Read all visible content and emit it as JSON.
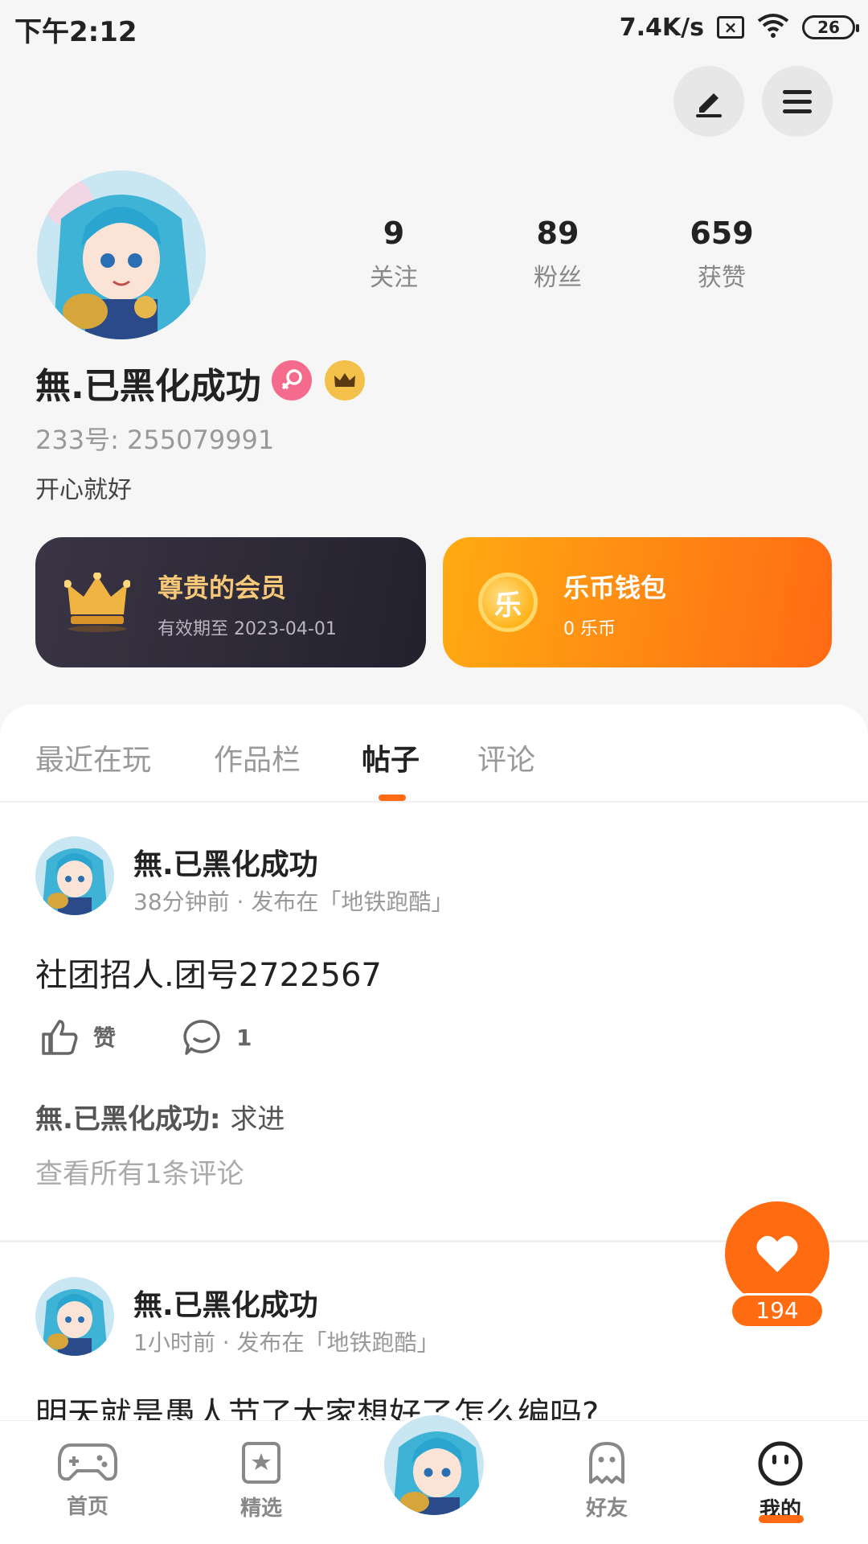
{
  "status_bar": {
    "time": "下午2:12",
    "net_speed": "7.4K/s",
    "sim_icon": "sim-off-icon",
    "battery": "26"
  },
  "header": {
    "edit_icon": "pencil-icon",
    "menu_icon": "hamburger-menu-icon"
  },
  "profile": {
    "stats": [
      {
        "value": "9",
        "label": "关注"
      },
      {
        "value": "89",
        "label": "粉丝"
      },
      {
        "value": "659",
        "label": "获赞"
      }
    ],
    "username": "無.已黑化成功",
    "id_text": "233号: 255079991",
    "bio": "开心就好",
    "gender_icon": "female-icon",
    "vip_icon": "crown-icon"
  },
  "cards": {
    "vip": {
      "title": "尊贵的会员",
      "subtitle": "有效期至 2023-04-01"
    },
    "wallet": {
      "title": "乐币钱包",
      "subtitle": "0 乐币",
      "coin_glyph": "乐"
    }
  },
  "tabs": {
    "items": [
      "最近在玩",
      "作品栏",
      "帖子",
      "评论"
    ],
    "active": "帖子"
  },
  "posts": [
    {
      "author": "無.已黑化成功",
      "meta": "38分钟前 · 发布在「地铁跑酷」",
      "text": "社团招人.团号2722567",
      "like_label": "赞",
      "comment_count": "1",
      "comment_author": "無.已黑化成功: ",
      "comment_text": "求进",
      "view_all": "查看所有1条评论"
    },
    {
      "author": "無.已黑化成功",
      "meta": "1小时前 · 发布在「地铁跑酷」",
      "text": "明天就是愚人节了大家想好了怎么编吗?"
    }
  ],
  "floating_like": {
    "count": "194"
  },
  "bottom_nav": {
    "items": [
      {
        "label": "首页",
        "icon": "gamepad-icon"
      },
      {
        "label": "精选",
        "icon": "star-card-icon"
      },
      {
        "label": "",
        "icon": "avatar-center"
      },
      {
        "label": "好友",
        "icon": "ghost-icon"
      },
      {
        "label": "我的",
        "icon": "smiley-face-icon"
      }
    ],
    "active": "我的"
  },
  "colors": {
    "accent": "#ff6a14",
    "vip_card": "#2b2734",
    "gold_text": "#f6c878",
    "gender_pink": "#f56b8d"
  }
}
